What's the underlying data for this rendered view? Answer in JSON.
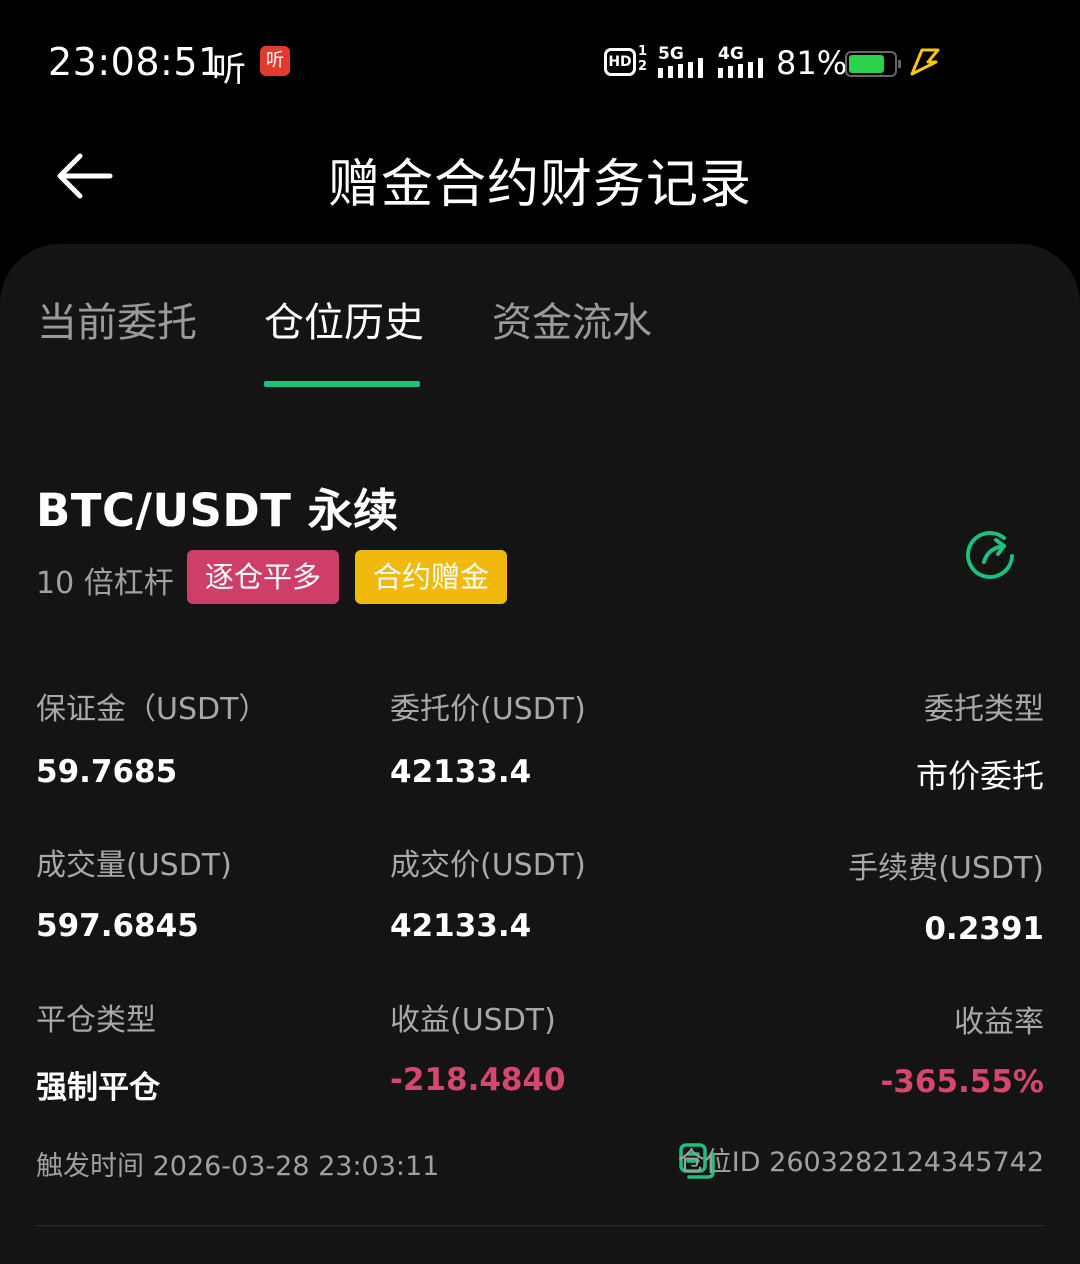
{
  "status_bar": {
    "time": "23:08:51",
    "ting": "听",
    "app_icon_text": "听",
    "hd_label": "HD",
    "hd_nums": [
      "1",
      "2"
    ],
    "net1": "5G",
    "net2": "4G",
    "battery_pct": "81%",
    "battery_level": 0.81
  },
  "header": {
    "title": "赠金合约财务记录",
    "back_icon": "arrow-left-icon"
  },
  "tabs": [
    {
      "label": "当前委托",
      "active": false
    },
    {
      "label": "仓位历史",
      "active": true
    },
    {
      "label": "资金流水",
      "active": false
    }
  ],
  "record": {
    "pair": "BTC/USDT 永续",
    "leverage": "10 倍杠杆",
    "tags": [
      "逐仓平多",
      "合约赠金"
    ],
    "share_icon": "share-icon",
    "fields": {
      "margin_label": "保证金（USDT）",
      "margin_value": "59.7685",
      "order_price_label": "委托价(USDT)",
      "order_price_value": "42133.4",
      "order_type_label": "委托类型",
      "order_type_value": "市价委托",
      "volume_label": "成交量(USDT)",
      "volume_value": "597.6845",
      "fill_price_label": "成交价(USDT)",
      "fill_price_value": "42133.4",
      "fee_label": "手续费(USDT)",
      "fee_value": "0.2391",
      "close_type_label": "平仓类型",
      "close_type_value": "强制平仓",
      "pnl_label": "收益(USDT)",
      "pnl_value": "-218.4840",
      "roi_label": "收益率",
      "roi_value": "-365.55%"
    },
    "trigger_time_label": "触发时间",
    "trigger_time": "2026-03-28 23:03:11",
    "position_id_label": "仓位ID",
    "position_id": "2603282124345742"
  },
  "colors": {
    "accent_green": "#1ec07e",
    "loss_red": "#d6476e",
    "tag_red": "#cf3e66",
    "tag_yellow": "#f0b90b"
  }
}
